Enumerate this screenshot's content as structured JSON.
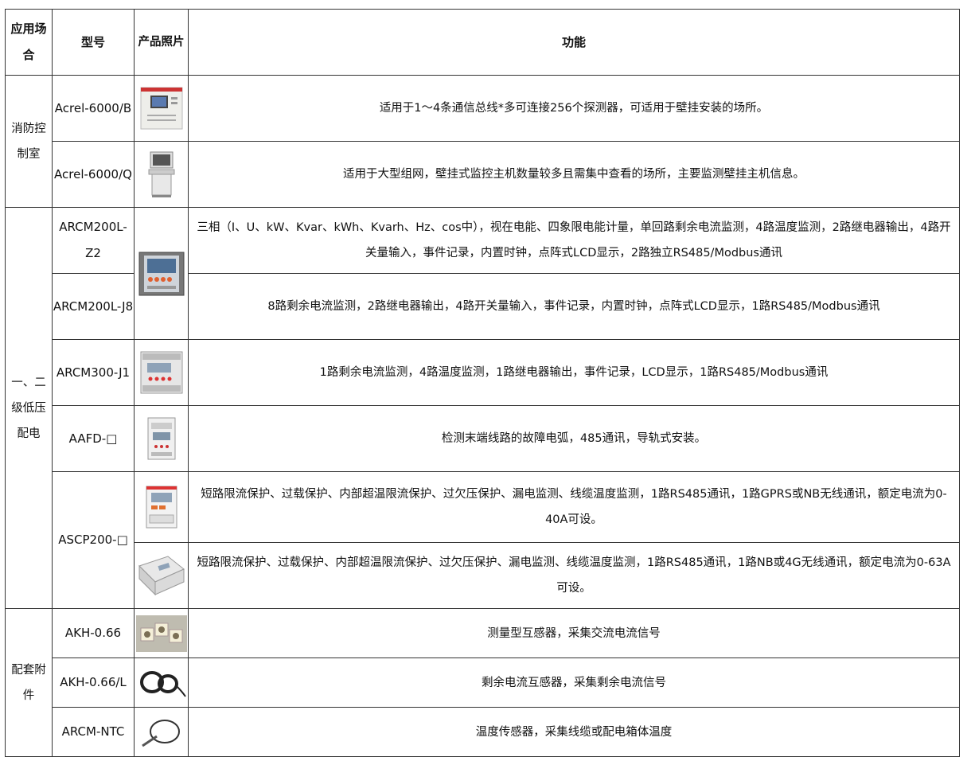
{
  "headers": {
    "scenario": "应用场合",
    "model": "型号",
    "photo": "产品照片",
    "function": "功能"
  },
  "rows": [
    {
      "category": "消防控制室",
      "model": "Acrel-6000/B",
      "function": "适用于1～4条通信总线*多可连接256个探测器，可适用于壁挂安装的场所。"
    },
    {
      "model": "Acrel-6000/Q",
      "function": "适用于大型组网，壁挂式监控主机数量较多且需集中查看的场所，主要监测壁挂主机信息。"
    },
    {
      "category": "一、二级低压配电",
      "model": "ARCM200L-Z2",
      "function": "三相（I、U、kW、Kvar、kWh、Kvarh、Hz、cos中），视在电能、四象限电能计量，单回路剩余电流监测，4路温度监测，2路继电器输出，4路开关量输入，事件记录，内置时钟，点阵式LCD显示，2路独立RS485/Modbus通讯"
    },
    {
      "model": "ARCM200L-J8",
      "function": "8路剩余电流监测，2路继电器输出，4路开关量输入，事件记录，内置时钟，点阵式LCD显示，1路RS485/Modbus通讯"
    },
    {
      "model": "ARCM300-J1",
      "function": "1路剩余电流监测，4路温度监测，1路继电器输出，事件记录，LCD显示，1路RS485/Modbus通讯"
    },
    {
      "model": "AAFD-□",
      "function": "检测末端线路的故障电弧，485通讯，导轨式安装。"
    },
    {
      "model": "ASCP200-□",
      "function": "短路限流保护、过载保护、内部超温限流保护、过欠压保护、漏电监测、线缆温度监测，1路RS485通讯，1路GPRS或NB无线通讯，额定电流为0-40A可设。"
    },
    {
      "function": "短路限流保护、过载保护、内部超温限流保护、过欠压保护、漏电监测、线缆温度监测，1路RS485通讯，1路NB或4G无线通讯，额定电流为0-63A可设。"
    },
    {
      "category": "配套附件",
      "model": "AKH-0.66",
      "function": "测量型互感器，采集交流电流信号"
    },
    {
      "model": "AKH-0.66/L",
      "function": "剩余电流互感器，采集剩余电流信号"
    },
    {
      "model": "ARCM-NTC",
      "function": "温度传感器，采集线缆或配电箱体温度"
    }
  ]
}
